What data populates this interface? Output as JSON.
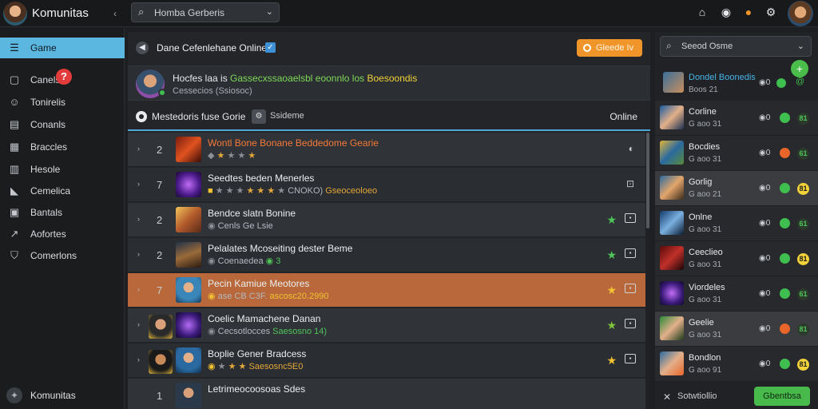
{
  "app": {
    "title": "Komunitas"
  },
  "topbar": {
    "search_placeholder": "Homba Gerberis"
  },
  "sidebar": {
    "items": [
      {
        "label": "Game",
        "icon": "list-icon"
      },
      {
        "label": "Canels",
        "icon": "box-icon",
        "badge": "?"
      },
      {
        "label": "Tonirelis",
        "icon": "users-icon"
      },
      {
        "label": "Conanls",
        "icon": "calendar-icon"
      },
      {
        "label": "Braccles",
        "icon": "stack-icon"
      },
      {
        "label": "Hesole",
        "icon": "grid-icon"
      },
      {
        "label": "Cemelica",
        "icon": "bookmark-icon"
      },
      {
        "label": "Bantals",
        "icon": "chat-icon"
      },
      {
        "label": "Aofortes",
        "icon": "chart-icon"
      },
      {
        "label": "Comerlons",
        "icon": "shield-icon"
      }
    ],
    "footer_label": "Komunitas"
  },
  "main": {
    "title": "Dane Cefenlehane Online",
    "action_button": "Gleede Iv",
    "profile": {
      "name_plain": "Hocfes laa is",
      "name_green": "Gassecxssaoaelsbl eoonnlo los",
      "name_yellow": "Boesoondis",
      "sub": "Cessecios (Ssiosoc)"
    },
    "filter": {
      "left": "Mestedoris fuse Gorie",
      "chip": "Ssideme",
      "right": "Online"
    },
    "rows": [
      {
        "num": "2",
        "title": "Wontl Bone Bonane Beddedome Gearie",
        "meta": "",
        "arrow": "›"
      },
      {
        "num": "7",
        "title": "Seedtes beden Menerles",
        "meta": "CNOKO)",
        "meta2": "Gseoceoloeo",
        "arrow": "›"
      },
      {
        "num": "2",
        "title": "Bendce slatn Bonine",
        "meta": "Cenls Ge Lsie",
        "arrow": "›"
      },
      {
        "num": "2",
        "title": "Pelalates Mcoseiting dester Beme",
        "meta": "Coenaedea",
        "meta2": "3",
        "arrow": "›"
      },
      {
        "num": "7",
        "title": "Pecin Kamiue Meotores",
        "meta": "ase CB C3F.",
        "meta2": "ascosc20.2990",
        "arrow": "›"
      },
      {
        "num": "",
        "title": "Coelic Mamachene Danan",
        "meta": "Cecsotlocces",
        "meta2": "Saesosno 14)",
        "arrow": "›"
      },
      {
        "num": "",
        "title": "Boplie Gener Bradcess",
        "meta": "Saesosnc5E0",
        "arrow": "›"
      },
      {
        "num": "1",
        "title": "Letrimeocoosoas Sdes",
        "meta": "",
        "arrow": "›"
      }
    ],
    "row_icons": [
      "eye-icon",
      "lock-icon",
      "card-icon",
      "card-icon",
      "card-icon",
      "card-icon",
      "card-icon",
      ""
    ]
  },
  "rpanel": {
    "search_label": "Seeod Osme",
    "head": {
      "name": "Dondel Boonedis",
      "sub": "Boos 21",
      "count": "0",
      "rank": "@"
    },
    "items": [
      {
        "name": "Corline",
        "sub": "G aoo 31",
        "count": "0",
        "rank": "81"
      },
      {
        "name": "Bocdies",
        "sub": "G aoo 31",
        "count": "0",
        "rank": "61"
      },
      {
        "name": "Gorlig",
        "sub": "G aoo 21",
        "count": "0",
        "rank": "81"
      },
      {
        "name": "Onlne",
        "sub": "G aoo 31",
        "count": "0",
        "rank": "61"
      },
      {
        "name": "Ceeclieo",
        "sub": "G aoo 31",
        "count": "0",
        "rank": "81"
      },
      {
        "name": "Viordeles",
        "sub": "G aoo 31",
        "count": "0",
        "rank": "61"
      },
      {
        "name": "Geelie",
        "sub": "G aoo 31",
        "count": "0",
        "rank": "81"
      },
      {
        "name": "Bondlon",
        "sub": "G aoo 91",
        "count": "0",
        "rank": "81"
      }
    ],
    "footer_label": "Sotwtiollio",
    "footer_button": "Gbentbsa"
  },
  "colors": {
    "accent": "#5bb6e0",
    "orange": "#f0952a",
    "green": "#48b94b",
    "active_row": "#b8683a"
  }
}
